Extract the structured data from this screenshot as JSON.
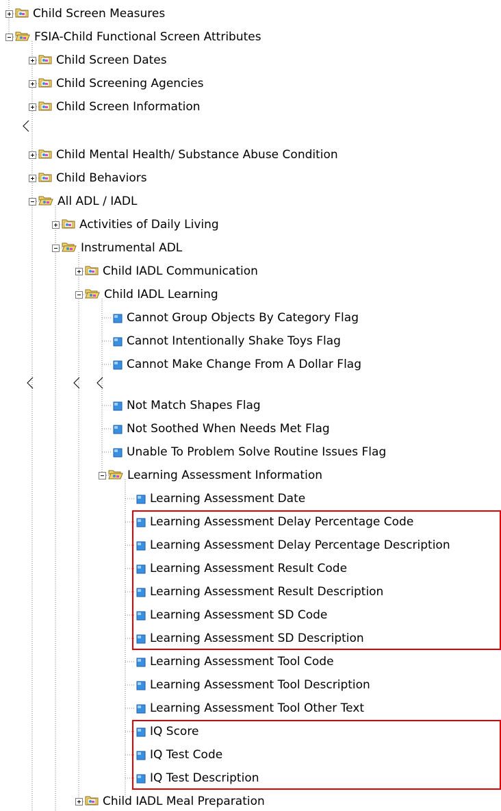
{
  "tree": {
    "nodes": [
      {
        "id": "n0",
        "label": "Child Screen Measures",
        "type": "folder",
        "expander": "plus"
      },
      {
        "id": "n1",
        "label": "FSIA-Child Functional Screen Attributes",
        "type": "folder-open",
        "expander": "minus"
      },
      {
        "id": "n2",
        "label": "Child Screen Dates",
        "type": "folder",
        "expander": "plus"
      },
      {
        "id": "n3",
        "label": "Child Screening Agencies",
        "type": "folder",
        "expander": "plus"
      },
      {
        "id": "n4",
        "label": "Child Screen Information",
        "type": "folder",
        "expander": "plus"
      },
      {
        "id": "n5",
        "label": "Child Mental Health/ Substance Abuse Condition",
        "type": "folder",
        "expander": "plus"
      },
      {
        "id": "n6",
        "label": "Child Behaviors",
        "type": "folder",
        "expander": "plus"
      },
      {
        "id": "n7",
        "label": "All ADL / IADL",
        "type": "folder-open",
        "expander": "minus"
      },
      {
        "id": "n8",
        "label": "Activities of Daily Living",
        "type": "folder",
        "expander": "plus"
      },
      {
        "id": "n9",
        "label": "Instrumental ADL",
        "type": "folder-open",
        "expander": "minus"
      },
      {
        "id": "n10",
        "label": "Child IADL Communication",
        "type": "folder",
        "expander": "plus"
      },
      {
        "id": "n11",
        "label": "Child IADL Learning",
        "type": "folder-open",
        "expander": "minus"
      },
      {
        "id": "n12",
        "label": "Cannot Group Objects By Category Flag",
        "type": "field"
      },
      {
        "id": "n13",
        "label": "Cannot Intentionally Shake Toys Flag",
        "type": "field"
      },
      {
        "id": "n14",
        "label": "Cannot Make Change From A Dollar Flag",
        "type": "field"
      },
      {
        "id": "n15",
        "label": "Not Match Shapes Flag",
        "type": "field"
      },
      {
        "id": "n16",
        "label": "Not Soothed When Needs Met Flag",
        "type": "field"
      },
      {
        "id": "n17",
        "label": "Unable To Problem Solve Routine Issues Flag",
        "type": "field"
      },
      {
        "id": "n18",
        "label": "Learning Assessment Information",
        "type": "folder-open",
        "expander": "minus"
      },
      {
        "id": "n19",
        "label": "Learning Assessment Date",
        "type": "field"
      },
      {
        "id": "n20",
        "label": "Learning Assessment Delay Percentage Code",
        "type": "field"
      },
      {
        "id": "n21",
        "label": "Learning Assessment Delay Percentage Description",
        "type": "field"
      },
      {
        "id": "n22",
        "label": "Learning Assessment Result Code",
        "type": "field"
      },
      {
        "id": "n23",
        "label": "Learning Assessment Result Description",
        "type": "field"
      },
      {
        "id": "n24",
        "label": "Learning Assessment SD Code",
        "type": "field"
      },
      {
        "id": "n25",
        "label": "Learning Assessment SD Description",
        "type": "field"
      },
      {
        "id": "n26",
        "label": "Learning Assessment Tool Code",
        "type": "field"
      },
      {
        "id": "n27",
        "label": "Learning Assessment Tool Description",
        "type": "field"
      },
      {
        "id": "n28",
        "label": "Learning Assessment Tool Other Text",
        "type": "field"
      },
      {
        "id": "n29",
        "label": "IQ Score",
        "type": "field"
      },
      {
        "id": "n30",
        "label": "IQ Test Code",
        "type": "field"
      },
      {
        "id": "n31",
        "label": "IQ Test Description",
        "type": "field"
      },
      {
        "id": "n32",
        "label": "Child IADL Meal Preparation",
        "type": "folder",
        "expander": "plus"
      }
    ],
    "highlight_groups": [
      {
        "name": "learning-assessment-delay-result-sd-group",
        "from": "n20",
        "to": "n25"
      },
      {
        "name": "iq-fields-group",
        "from": "n29",
        "to": "n31"
      }
    ]
  },
  "colors": {
    "highlight": "#e00000",
    "folder": "#f2d36b",
    "field": "#3b8fe0",
    "connector": "#808080"
  }
}
